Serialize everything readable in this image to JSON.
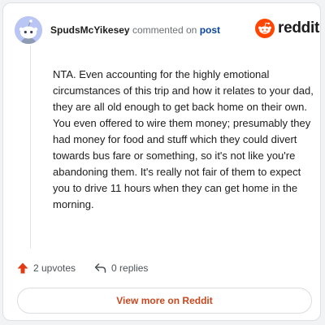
{
  "header": {
    "username": "SpudsMcYikesey",
    "action_text": "commented on",
    "post_link": "post"
  },
  "logo": {
    "icon": "reddit-snoo-icon",
    "text": "reddit",
    "color": "#ff4500"
  },
  "comment": {
    "body": "NTA. Even accounting for the highly emotional circumstances of this trip and how it relates to your dad, they are all old enough to get back home on their own. You even offered to wire them money; presumably they had money for food and stuff which they could divert towards bus fare or something, so it's not like you're abandoning them. It's really not fair of them to expect you to drive 11 hours when they can get home in the morning."
  },
  "actions": {
    "upvotes": "2 upvotes",
    "upvote_icon": "upvote-arrow-icon",
    "replies": "0 replies",
    "reply_icon": "reply-arrow-icon"
  },
  "footer": {
    "view_more": "View more on Reddit"
  },
  "colors": {
    "accent": "#d93a00",
    "link": "#0a449b",
    "upvote": "#e03b12"
  }
}
